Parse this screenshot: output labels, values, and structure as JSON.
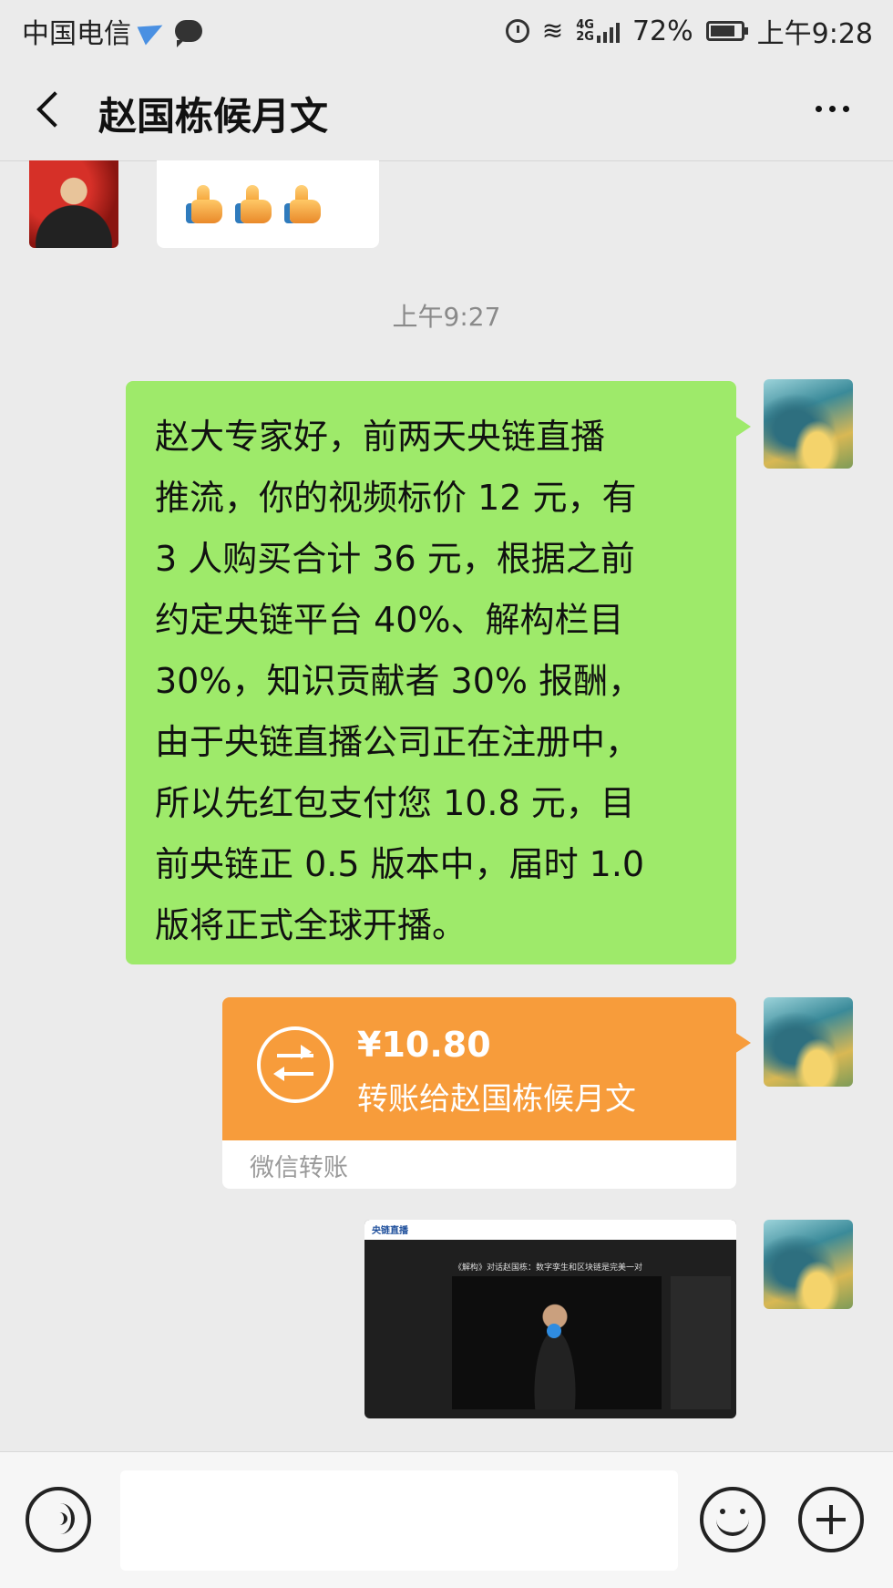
{
  "status_bar": {
    "carrier": "中国电信",
    "battery": "72%",
    "time": "上午9:28"
  },
  "header": {
    "title": "赵国栋候月文"
  },
  "messages": {
    "timestamp": "上午9:27",
    "text_lines": [
      "赵大专家好，前两天央链直播",
      "推流，你的视频标价 12 元，有",
      "3 人购买合计 36 元，根据之前",
      "约定央链平台 40%、解构栏目",
      "30%，知识贡献者 30% 报酬，",
      "由于央链直播公司正在注册中，",
      "所以先红包支付您 10.8 元，目",
      "前央链正 0.5 版本中，届时 1.0",
      "版将正式全球开播。"
    ],
    "transfer": {
      "amount": "¥10.80",
      "description": "转账给赵国栋候月文",
      "label": "微信转账"
    },
    "video_card": {
      "logo": "央链直播",
      "title": "《解构》对话赵国栋：数字孪生和区块链是完美一对"
    }
  },
  "input_bar": {
    "placeholder": ""
  }
}
